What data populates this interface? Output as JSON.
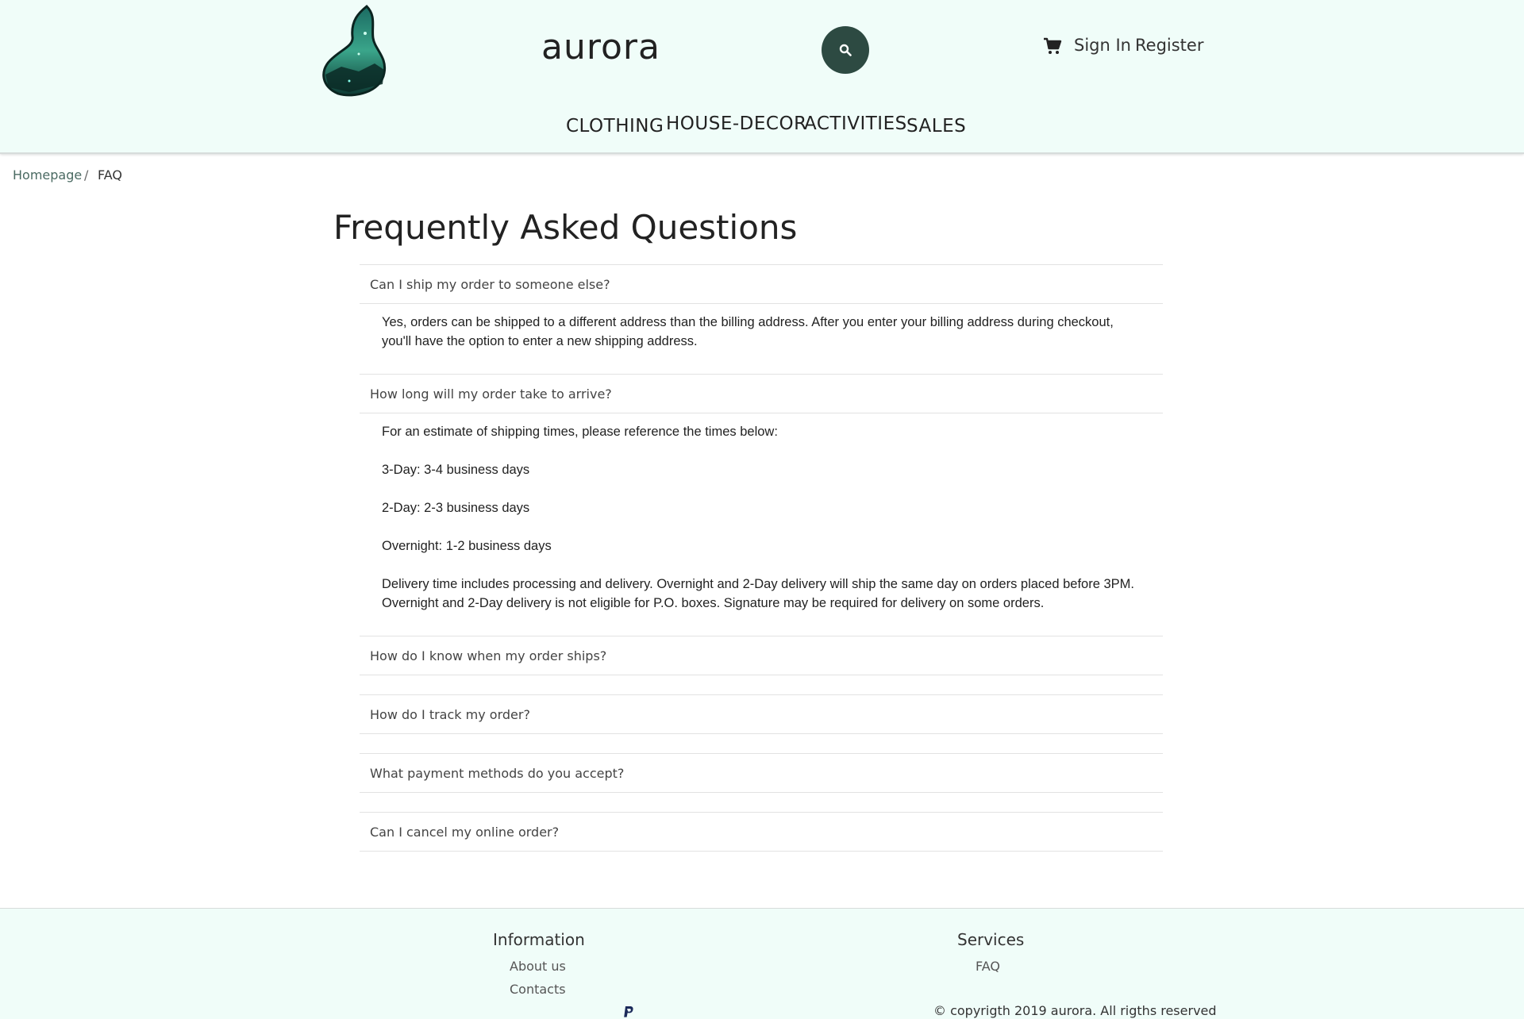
{
  "header": {
    "brand": "aurora",
    "auth": {
      "sign_in": "Sign In",
      "register": "Register"
    },
    "nav": [
      "CLOTHING",
      "HOUSE-DECOR",
      "ACTIVITIES",
      "SALES"
    ],
    "colors": {
      "background": "#f0fdf9",
      "search_button": "#2d4a42"
    }
  },
  "breadcrumb": {
    "home": "Homepage",
    "separator": "/",
    "current": "FAQ"
  },
  "page": {
    "title": "Frequently Asked Questions"
  },
  "faq": [
    {
      "question": "Can I ship my order to someone else?",
      "answer": [
        "Yes, orders can be shipped to a different address than the billing address. After you enter your billing address during checkout, you'll have the option to enter a new shipping address."
      ]
    },
    {
      "question": "How long will my order take to arrive?",
      "answer": [
        "For an estimate of shipping times, please reference the times below:",
        "3-Day: 3-4 business days",
        "2-Day: 2-3 business days",
        "Overnight: 1-2 business days",
        "Delivery time includes processing and delivery. Overnight and 2-Day delivery will ship the same day on orders placed before 3PM. Overnight and 2-Day delivery is not eligible for P.O. boxes. Signature may be required for delivery on some orders."
      ]
    },
    {
      "question": "How do I know when my order ships?"
    },
    {
      "question": "How do I track my order?"
    },
    {
      "question": "What payment methods do you accept?"
    },
    {
      "question": "Can I cancel my online order?"
    }
  ],
  "footer": {
    "information": {
      "heading": "Information",
      "links": [
        "About us",
        "Contacts"
      ]
    },
    "services": {
      "heading": "Services",
      "links": [
        "FAQ"
      ]
    },
    "copyright": "© copyrigth 2019 aurora. All rigths reserved"
  }
}
